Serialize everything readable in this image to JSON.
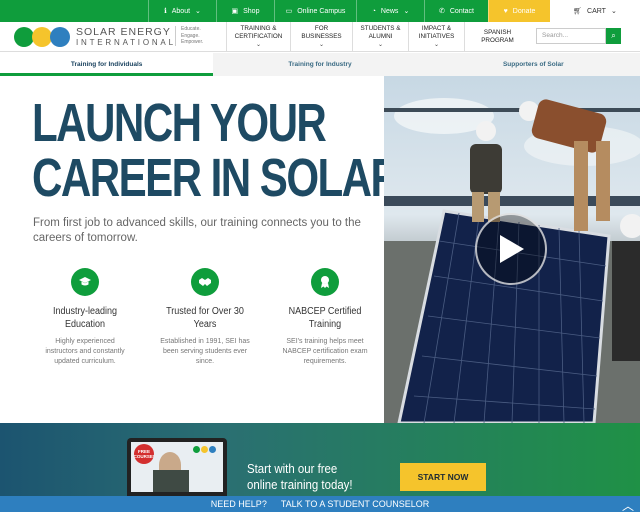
{
  "topbar": {
    "about": "About",
    "shop": "Shop",
    "online_campus": "Online Campus",
    "news": "News",
    "contact": "Contact",
    "donate": "Donate",
    "cart": "CART"
  },
  "header": {
    "logo_line1": "SOLAR ENERGY",
    "logo_line2": "INTERNATIONAL",
    "tagline": "Educate. Engage. Empower.",
    "nav": [
      {
        "label": "TRAINING & CERTIFICATION"
      },
      {
        "label": "FOR BUSINESSES"
      },
      {
        "label": "STUDENTS & ALUMNI"
      },
      {
        "label": "IMPACT & INITIATIVES"
      },
      {
        "label": "SPANISH PROGRAM"
      }
    ],
    "search_placeholder": "Search..."
  },
  "subtabs": [
    {
      "label": "Training for Individuals",
      "active": true
    },
    {
      "label": "Training for Industry",
      "active": false
    },
    {
      "label": "Supporters of Solar",
      "active": false
    }
  ],
  "hero": {
    "headline_line1": "LAUNCH YOUR",
    "headline_line2": "CAREER IN SOLAR",
    "subtext": "From first job to advanced skills, our training connects you to the careers of tomorrow.",
    "features": [
      {
        "icon": "graduation-cap-icon",
        "title": "Industry-leading Education",
        "desc": "Highly experienced instructors and constantly updated curriculum."
      },
      {
        "icon": "handshake-icon",
        "title": "Trusted for Over 30 Years",
        "desc": "Established in 1991, SEI has been serving students ever since."
      },
      {
        "icon": "award-ribbon-icon",
        "title": "NABCEP Certified Training",
        "desc": "SEI's training helps meet NABCEP certification exam requirements."
      }
    ]
  },
  "banner": {
    "badge": "FREE COURSE!",
    "title": "Start with our free online training today!",
    "button": "START NOW"
  },
  "helpbar": {
    "need_help": "NEED HELP?",
    "counselor": "TALK TO A STUDENT COUNSELOR"
  },
  "colors": {
    "brand_green": "#0f9d3c",
    "donate_yellow": "#f5c42c",
    "headline_navy": "#1e4a63",
    "help_blue": "#2e7fbf"
  }
}
